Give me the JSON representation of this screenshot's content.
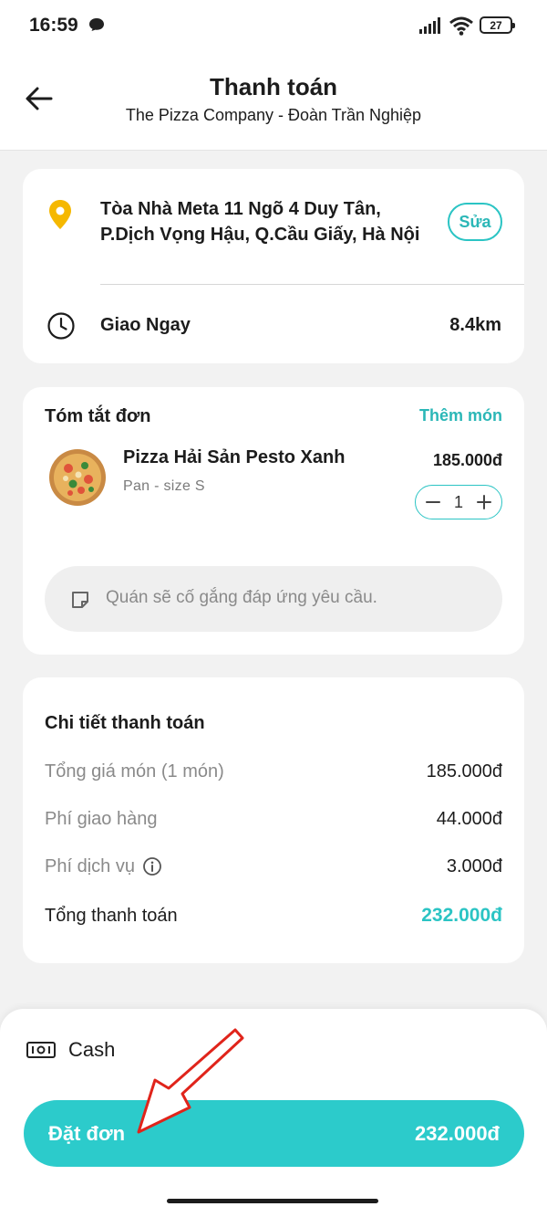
{
  "status_bar": {
    "time": "16:59",
    "battery": "27"
  },
  "header": {
    "title": "Thanh toán",
    "subtitle": "The Pizza Company - Đoàn Trần Nghiệp"
  },
  "address": {
    "line1": "Tòa Nhà Meta 11 Ngõ 4 Duy Tân,",
    "line2": "P.Dịch Vọng Hậu, Q.Cầu Giấy, Hà Nội",
    "edit_label": "Sửa",
    "delivery_label": "Giao Ngay",
    "distance": "8.4km"
  },
  "summary": {
    "title": "Tóm tắt đơn",
    "add_label": "Thêm món",
    "items": [
      {
        "name": "Pizza Hải Sản Pesto Xanh",
        "variant": "Pan - size S",
        "price": "185.000đ",
        "quantity": "1"
      }
    ],
    "note_placeholder": "Quán sẽ cố gắng đáp ứng yêu cầu."
  },
  "payment": {
    "title": "Chi tiết thanh toán",
    "rows": [
      {
        "label": "Tổng giá món (1 món)",
        "value": "185.000đ"
      },
      {
        "label": "Phí giao hàng",
        "value": "44.000đ"
      },
      {
        "label": "Phí dịch vụ",
        "value": "3.000đ"
      }
    ],
    "total_label": "Tổng thanh toán",
    "total_value": "232.000đ"
  },
  "bottom": {
    "method": "Cash",
    "order_label": "Đặt đơn",
    "order_total": "232.000đ"
  },
  "colors": {
    "accent": "#2ccbcb",
    "pin": "#f5b800"
  },
  "icons": [
    "back-arrow-icon",
    "location-pin-icon",
    "clock-icon",
    "note-icon",
    "info-icon",
    "cash-icon"
  ]
}
